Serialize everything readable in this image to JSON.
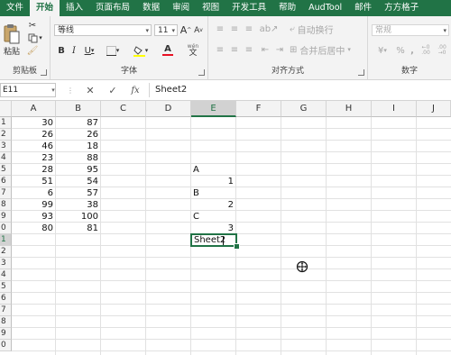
{
  "ribbon_tabs": [
    "文件",
    "开始",
    "插入",
    "页面布局",
    "数据",
    "审阅",
    "视图",
    "开发工具",
    "帮助",
    "AudTool",
    "邮件",
    "方方格子"
  ],
  "clipboard": {
    "paste_label": "粘贴",
    "group_label": "剪贴板"
  },
  "font": {
    "name": "等线",
    "size": "11",
    "bold": "B",
    "italic": "I",
    "underline": "U",
    "grow": "A",
    "shrink": "A",
    "font_color_letter": "A",
    "wen": "wén",
    "group_label": "字体",
    "color_accent": "#e81123"
  },
  "alignment": {
    "wrap_label": "自动换行",
    "merge_label": "合并后居中",
    "group_label": "对齐方式"
  },
  "number": {
    "format": "常规",
    "currency": "¥",
    "percent": "%",
    "comma": ",",
    "inc_dec": "←0 .00",
    "dec_dec": ".00 →0",
    "group_label": "数字"
  },
  "formula_bar": {
    "name_box": "E11",
    "cancel_symbol": "✕",
    "enter_symbol": "✓",
    "fx_label": "fx",
    "content": "Sheet2"
  },
  "grid": {
    "columns": [
      "A",
      "B",
      "C",
      "D",
      "E",
      "F",
      "G",
      "H",
      "I",
      "J"
    ],
    "selected_column": "E",
    "rows": [
      "1",
      "2",
      "3",
      "4",
      "5",
      "6",
      "7",
      "8",
      "9",
      "0",
      "1",
      "2",
      "3",
      "4",
      "5",
      "6",
      "7",
      "8",
      "9",
      "0"
    ],
    "selected_row_index": 10,
    "col_a": [
      "30",
      "26",
      "46",
      "23",
      "28",
      "51",
      "6",
      "99",
      "93",
      "80"
    ],
    "col_b": [
      "87",
      "26",
      "18",
      "88",
      "95",
      "54",
      "57",
      "38",
      "100",
      "81"
    ],
    "col_e": [
      "",
      "",
      "",
      "",
      "A",
      "1",
      "B",
      "2",
      "C",
      "3"
    ],
    "active_cell_value": "Sheet2"
  },
  "colors": {
    "ribbon_green": "#217346",
    "selection_border": "#217346"
  }
}
